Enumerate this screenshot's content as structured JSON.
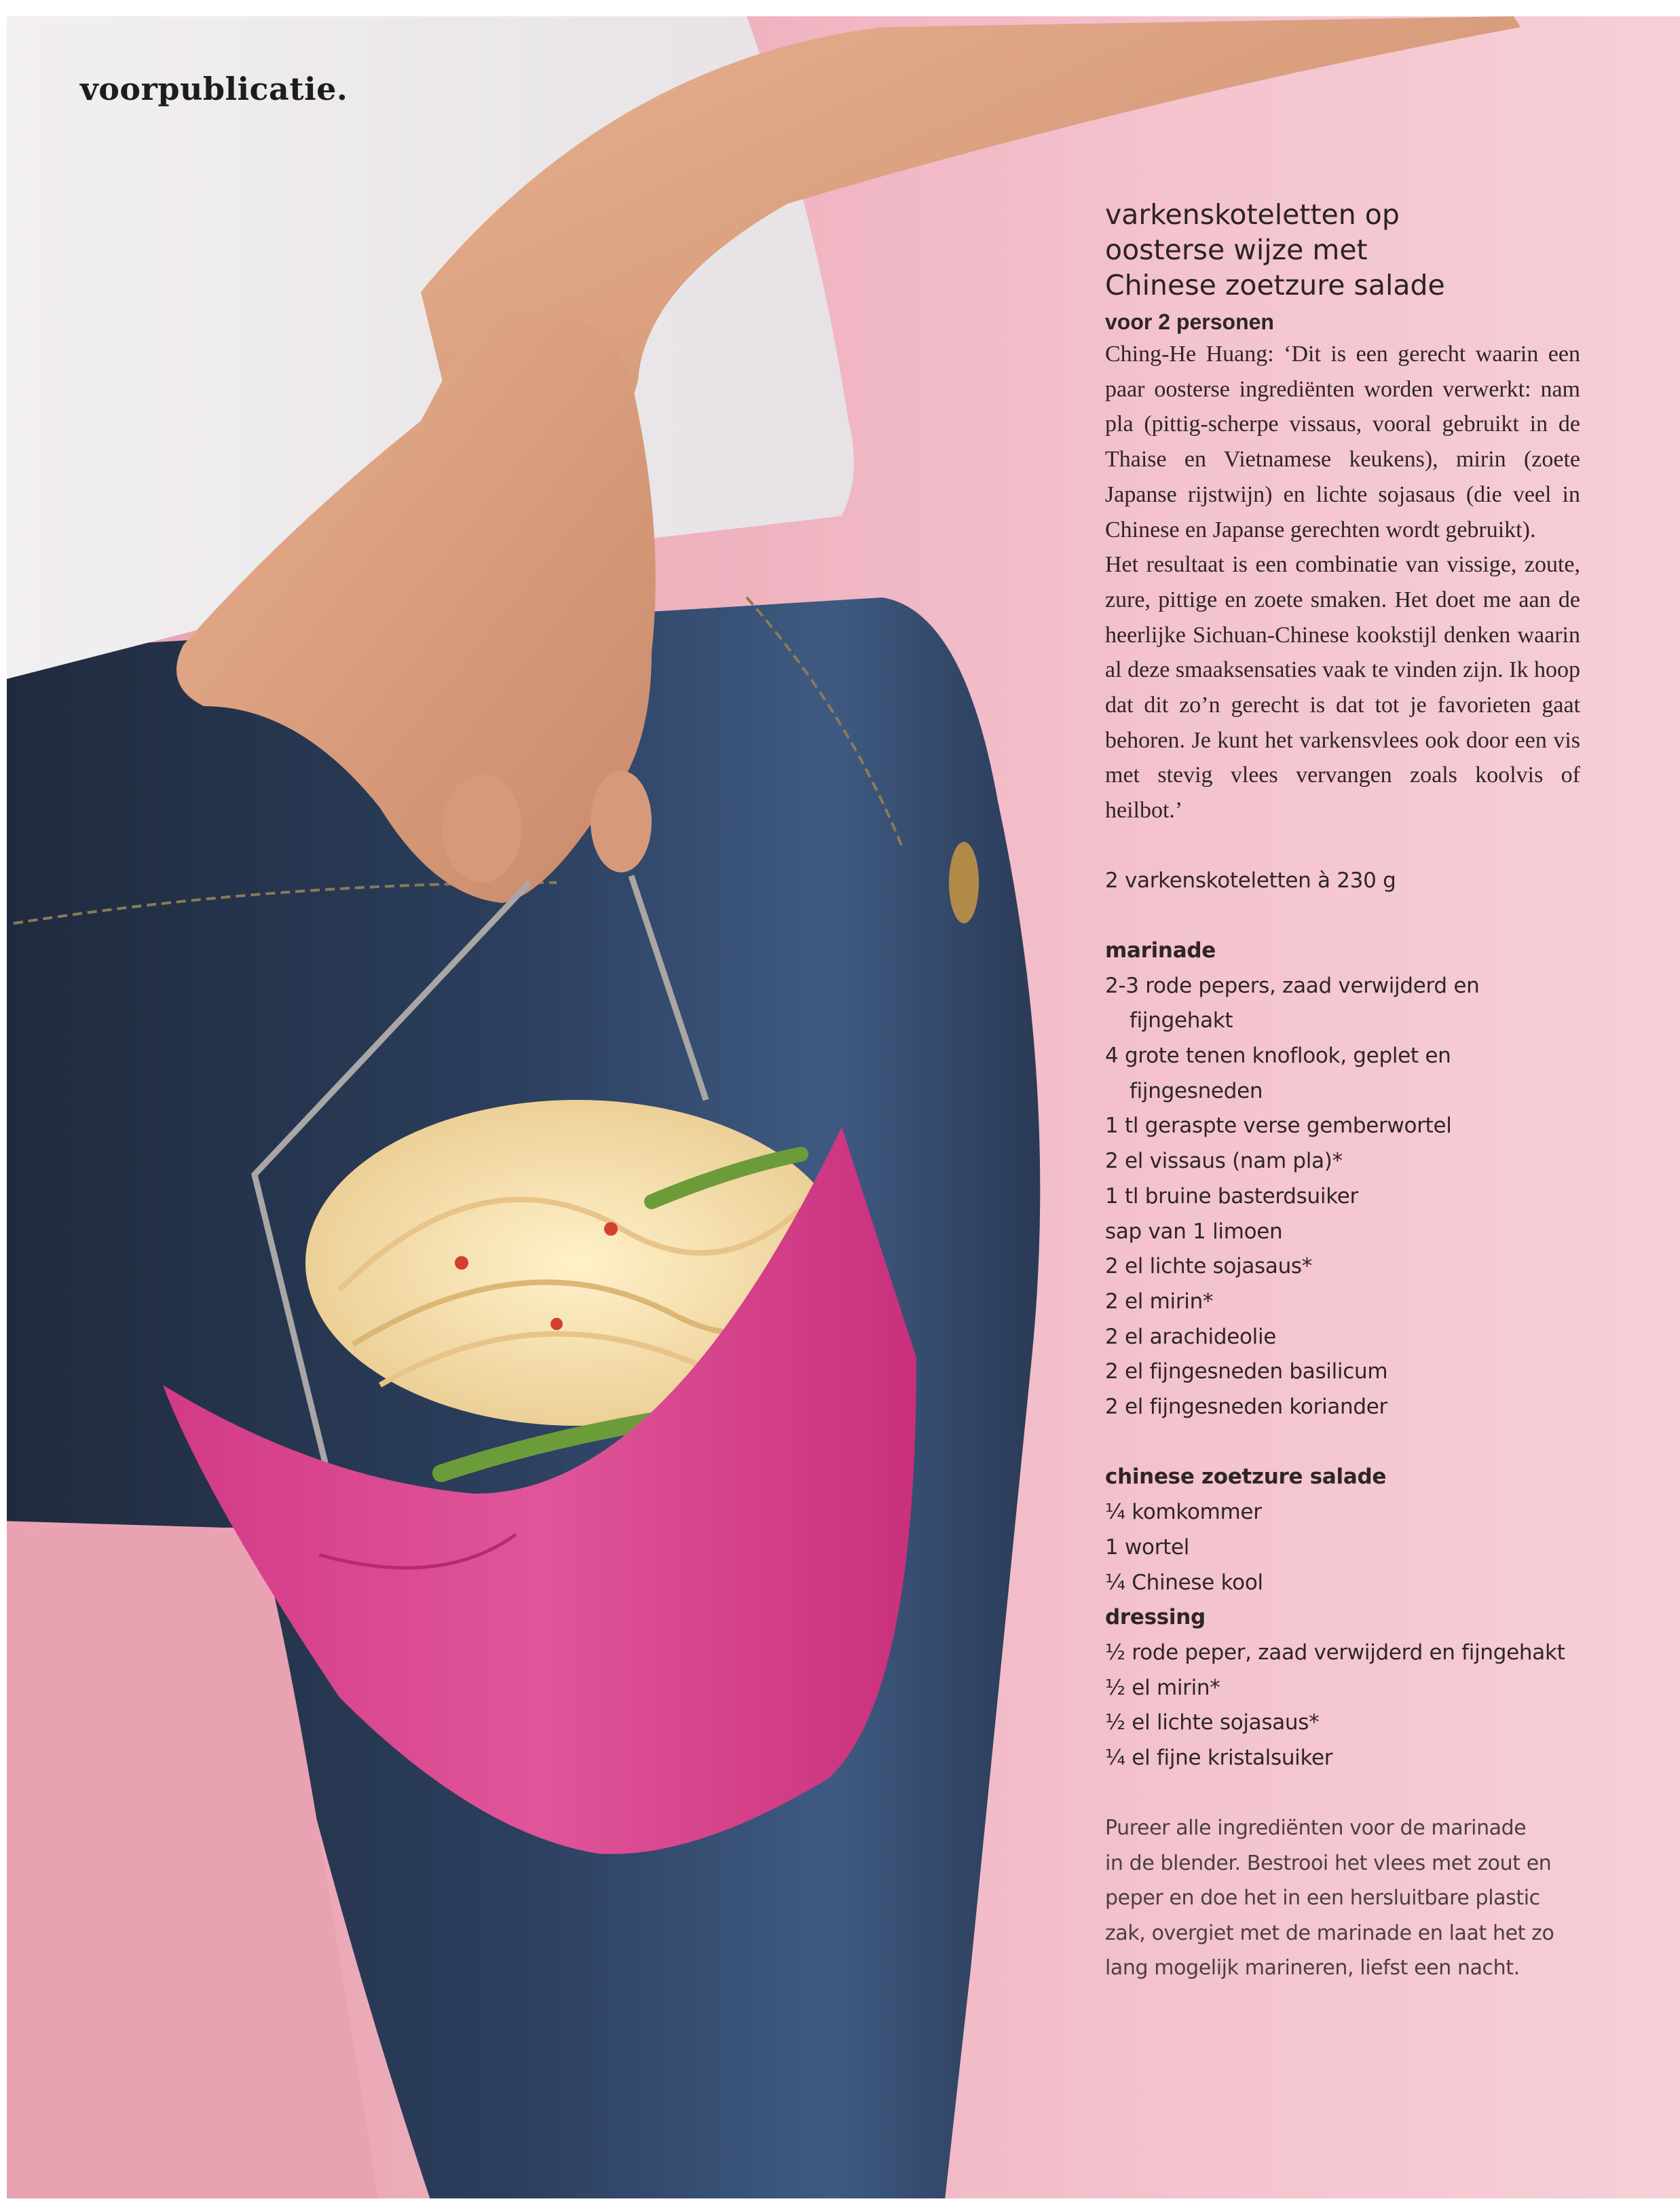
{
  "header": {
    "brand": "voorpublicatie."
  },
  "photo": {
    "icon": "woman-holding-pink-noodle-box-image"
  },
  "recipe": {
    "title_lines": [
      "varkenskoteletten op",
      "oosterse wijze met",
      "Chinese zoetzure salade"
    ],
    "serves": "voor 2 personen",
    "intro": [
      "Ching-He Huang: ‘Dit is een gerecht waarin een paar oosterse ingrediënten worden verwerkt: nam pla (pittig-scherpe vissaus, vooral gebruikt in de Thaise en Vietnamese keukens), mirin (zoete Japanse rijstwijn) en lichte sojasaus (die veel in Chinese en Japanse gerechten wordt gebruikt).",
      "Het resultaat is een combinatie van vissige, zoute, zure, pittige en zoete smaken. Het doet me aan de heerlijke Sichuan-Chinese kookstijl denken waarin al deze smaaksensaties vaak te vinden zijn. Ik hoop dat dit zo’n gerecht is dat tot je favorieten gaat behoren. Je kunt het varkensvlees ook door een vis met stevig vlees vervangen zoals koolvis of heilbot.’"
    ],
    "main_ingredient": "2 varkenskoteletten à 230 g",
    "marinade": {
      "heading": "marinade",
      "items": [
        {
          "first": "2-3 rode pepers, zaad verwijderd en",
          "cont": "fijngehakt"
        },
        {
          "first": "4 grote tenen knoflook, geplet en",
          "cont": "fijngesneden"
        },
        {
          "first": "1 tl geraspte verse gemberwortel"
        },
        {
          "first": "2 el vissaus (nam pla)*"
        },
        {
          "first": "1 tl bruine basterdsuiker"
        },
        {
          "first": "sap van 1 limoen"
        },
        {
          "first": "2 el lichte sojasaus*"
        },
        {
          "first": "2 el mirin*"
        },
        {
          "first": "2 el arachideolie"
        },
        {
          "first": "2 el fijngesneden basilicum"
        },
        {
          "first": "2 el fijngesneden koriander"
        }
      ]
    },
    "salad": {
      "heading": "chinese zoetzure salade",
      "items": [
        "¼ komkommer",
        "1 wortel",
        "¼ Chinese kool"
      ],
      "dressing_heading": "dressing",
      "dressing_items": [
        "½ rode peper, zaad verwijderd en fijngehakt",
        "½ el mirin*",
        "½ el lichte sojasaus*",
        "¼ el fijne kristalsuiker"
      ]
    },
    "method_lines": [
      "Pureer alle ingrediënten voor de marinade",
      "in de blender. Bestrooi het vlees met zout en",
      "peper en doe het in een hersluitbare plastic",
      "zak, overgiet met de marinade en laat het zo",
      "lang mogelijk marineren, liefst een nacht."
    ]
  }
}
